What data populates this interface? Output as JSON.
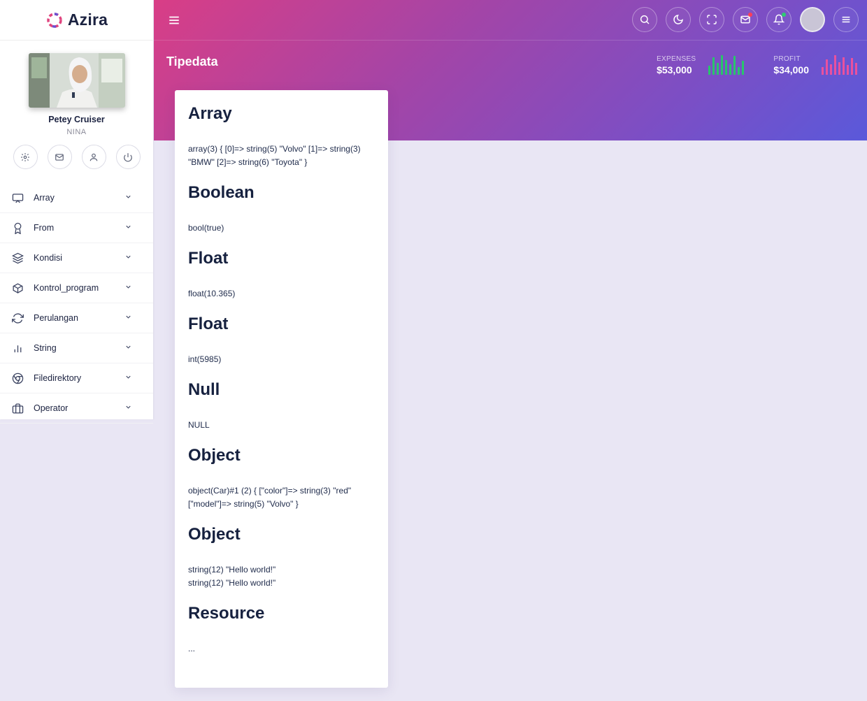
{
  "brand": {
    "name": "Azira"
  },
  "profile": {
    "name": "Petey Cruiser",
    "role": "NINA"
  },
  "profile_actions": [
    "settings-icon",
    "mail-icon",
    "user-icon",
    "power-icon"
  ],
  "menu": [
    {
      "label": "Array",
      "icon": "monitor-icon"
    },
    {
      "label": "From",
      "icon": "award-icon"
    },
    {
      "label": "Kondisi",
      "icon": "layers-icon"
    },
    {
      "label": "Kontrol_program",
      "icon": "box-icon"
    },
    {
      "label": "Perulangan",
      "icon": "refresh-icon"
    },
    {
      "label": "String",
      "icon": "bar-chart-icon"
    },
    {
      "label": "Filedirektory",
      "icon": "chrome-icon"
    },
    {
      "label": "Operator",
      "icon": "briefcase-icon"
    }
  ],
  "header": {
    "title": "Tipedata",
    "actions": [
      "search-icon",
      "moon-icon",
      "fullscreen-icon",
      "mail-icon",
      "bell-icon",
      "avatar",
      "menu-icon"
    ],
    "stats": [
      {
        "label": "EXPENSES",
        "value": "$53,000",
        "color": "#29c46c",
        "bars": [
          0.45,
          0.9,
          0.6,
          1.0,
          0.75,
          0.55,
          0.95,
          0.4,
          0.7
        ]
      },
      {
        "label": "PROFIT",
        "value": "$34,000",
        "color": "#e9519e",
        "bars": [
          0.4,
          0.8,
          0.55,
          1.0,
          0.65,
          0.9,
          0.5,
          0.85,
          0.6
        ]
      }
    ]
  },
  "accent_colors": {
    "gradient_start": "#d93e86",
    "gradient_end": "#5a59da",
    "background": "#e9e6f4"
  },
  "content": {
    "sections": [
      {
        "title": "Array",
        "body": "array(3) { [0]=> string(5) \"Volvo\" [1]=> string(3) \"BMW\" [2]=> string(6) \"Toyota\" }"
      },
      {
        "title": "Boolean",
        "body": "bool(true)"
      },
      {
        "title": "Float",
        "body": "float(10.365)"
      },
      {
        "title": "Float",
        "body": "int(5985)"
      },
      {
        "title": "Null",
        "body": "NULL"
      },
      {
        "title": "Object",
        "body": "object(Car)#1 (2) { [\"color\"]=> string(3) \"red\" [\"model\"]=> string(5) \"Volvo\" }"
      },
      {
        "title": "Object",
        "body_lines": [
          "string(12) \"Hello world!\"",
          "string(12) \"Hello world!\""
        ]
      },
      {
        "title": "Resource",
        "body": "..."
      }
    ]
  }
}
